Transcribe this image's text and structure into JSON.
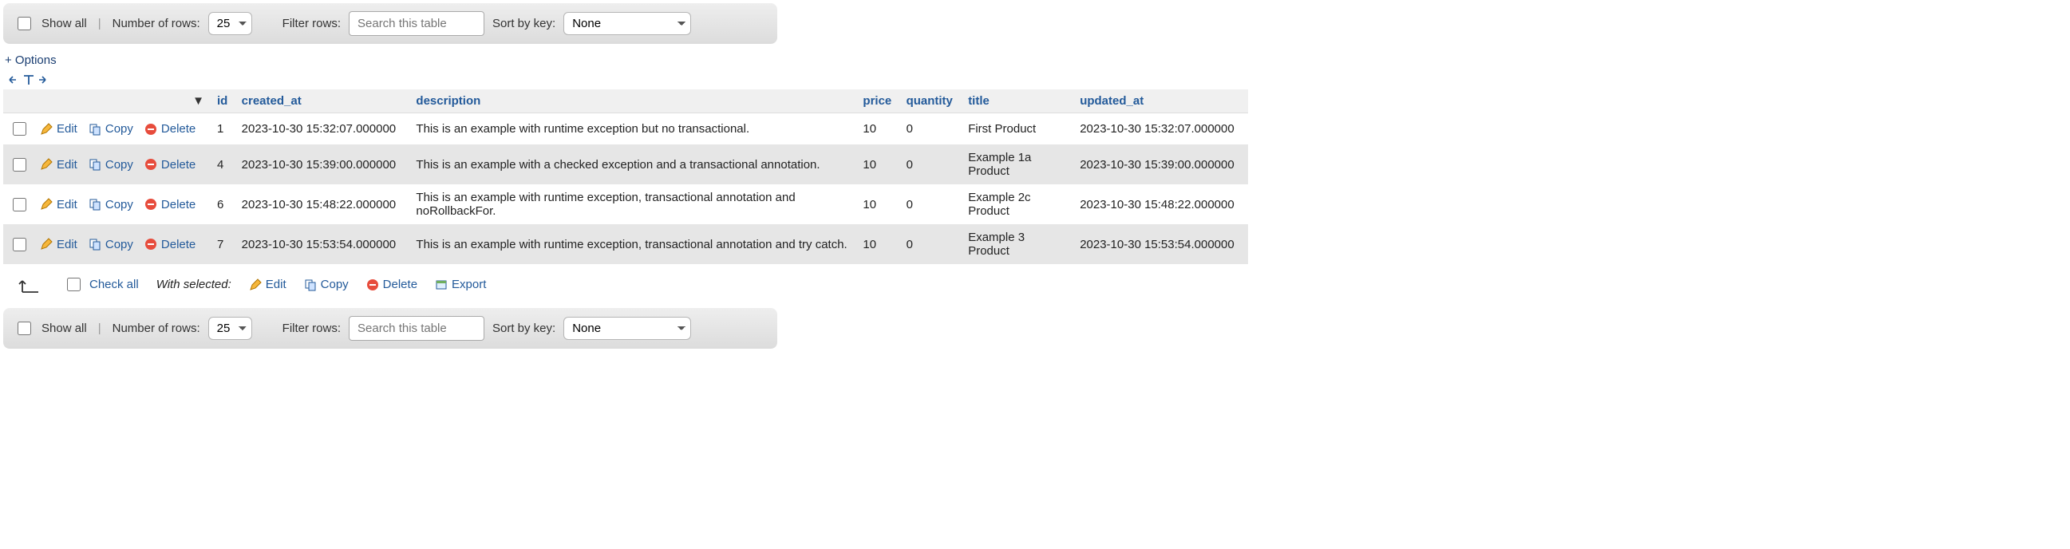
{
  "toolbar": {
    "show_all_label": "Show all",
    "rows_label": "Number of rows:",
    "rows_value": "25",
    "filter_label": "Filter rows:",
    "filter_placeholder": "Search this table",
    "sort_label": "Sort by key:",
    "sort_value": "None"
  },
  "options_link": "+ Options",
  "columns": {
    "id": "id",
    "created_at": "created_at",
    "description": "description",
    "price": "price",
    "quantity": "quantity",
    "title": "title",
    "updated_at": "updated_at"
  },
  "row_actions": {
    "edit": "Edit",
    "copy": "Copy",
    "delete": "Delete"
  },
  "rows": [
    {
      "id": "1",
      "created_at": "2023-10-30 15:32:07.000000",
      "description": "This is an example with runtime exception but no transactional.",
      "price": "10",
      "quantity": "0",
      "title": "First Product",
      "updated_at": "2023-10-30 15:32:07.000000"
    },
    {
      "id": "4",
      "created_at": "2023-10-30 15:39:00.000000",
      "description": "This is an example with a checked exception and a transactional annotation.",
      "price": "10",
      "quantity": "0",
      "title": "Example 1a Product",
      "updated_at": "2023-10-30 15:39:00.000000"
    },
    {
      "id": "6",
      "created_at": "2023-10-30 15:48:22.000000",
      "description": "This is an example with runtime exception, transactional annotation and noRollbackFor.",
      "price": "10",
      "quantity": "0",
      "title": "Example 2c Product",
      "updated_at": "2023-10-30 15:48:22.000000"
    },
    {
      "id": "7",
      "created_at": "2023-10-30 15:53:54.000000",
      "description": "This is an example with runtime exception, transactional annotation and try catch.",
      "price": "10",
      "quantity": "0",
      "title": "Example 3 Product",
      "updated_at": "2023-10-30 15:53:54.000000"
    }
  ],
  "footer": {
    "check_all": "Check all",
    "with_selected": "With selected:",
    "edit": "Edit",
    "copy": "Copy",
    "delete": "Delete",
    "export": "Export"
  }
}
